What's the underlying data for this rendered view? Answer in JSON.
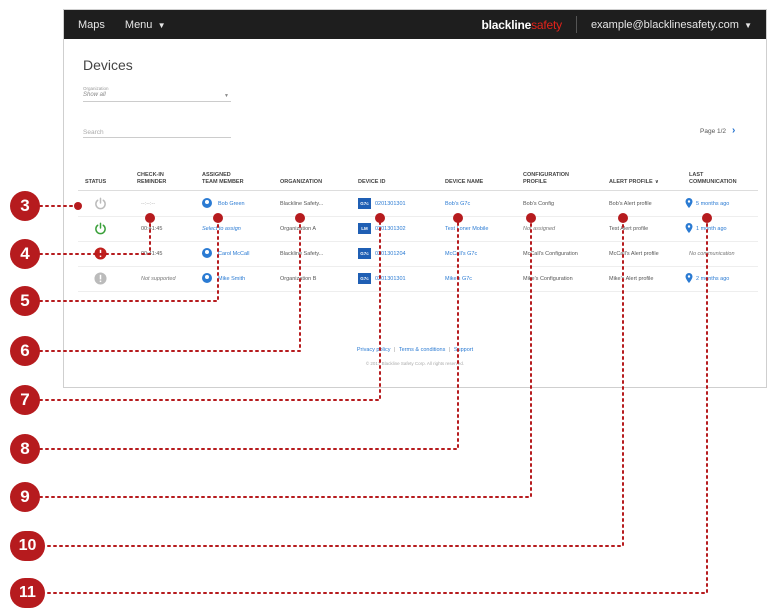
{
  "topbar": {
    "maps": "Maps",
    "menu": "Menu",
    "brand_main": "blackline",
    "brand_accent": "safety",
    "account": "example@blacklinesafety.com"
  },
  "page": {
    "title": "Devices",
    "org_label": "Organization",
    "org_value": "Show all",
    "search_placeholder": "Search",
    "page_info": "Page 1/2"
  },
  "columns": {
    "status": "STATUS",
    "checkin": [
      "CHECK-IN",
      "REMINDER"
    ],
    "assigned": [
      "ASSIGNED",
      "TEAM MEMBER"
    ],
    "organization": "ORGANIZATION",
    "device_id": "DEVICE ID",
    "device_name": "DEVICE NAME",
    "config": [
      "CONFIGURATION",
      "PROFILE"
    ],
    "alert": "ALERT PROFILE",
    "last": [
      "LAST",
      "COMMUNICATION"
    ]
  },
  "rows": [
    {
      "checkin": "--:--:--",
      "member": "Bob Green",
      "org": "Blackline Safety...",
      "badge": "G7c",
      "device_id": "0201301301",
      "device_name": "Bob's G7c",
      "config": "Bob's Config",
      "alert": "Bob's Alert profile",
      "last": "5 months ago"
    },
    {
      "checkin": "00:41:45",
      "member": "Select to assign",
      "org": "Organization A",
      "badge": "LM",
      "device_id": "0201301302",
      "device_name": "Test Loner Mobile",
      "config": "Not assigned",
      "alert": "Test Alert profile",
      "last": "1 month ago"
    },
    {
      "checkin": "00:41:45",
      "member": "Carol McCall",
      "org": "Blackline Safety...",
      "badge": "G7c",
      "device_id": "0201301204",
      "device_name": "McCall's G7c",
      "config": "McCall's Configuration",
      "alert": "McCall's Alert profile",
      "last": "No communication"
    },
    {
      "checkin": "Not supported",
      "member": "Mike Smith",
      "org": "Organization B",
      "badge": "G7c",
      "device_id": "0201301301",
      "device_name": "Mike's G7c",
      "config": "Mike's Configuration",
      "alert": "Mike's Alert profile",
      "last": "2 months ago"
    }
  ],
  "footer": {
    "privacy": "Privacy policy",
    "terms": "Terms & conditions",
    "support": "Support",
    "separator": "|",
    "copyright": "© 2017 Blackline Safety Corp. All rights reserved."
  },
  "callouts": [
    "3",
    "4",
    "5",
    "6",
    "7",
    "8",
    "9",
    "10",
    "11"
  ],
  "colors": {
    "topbar": "#1e1e1e",
    "accent_red": "#e2231a",
    "link_blue": "#2b7bd3",
    "callout_red": "#b61b1e",
    "status_gray": "#bbbbbb",
    "status_green": "#3aa03a",
    "alert_red": "#c0201d"
  }
}
